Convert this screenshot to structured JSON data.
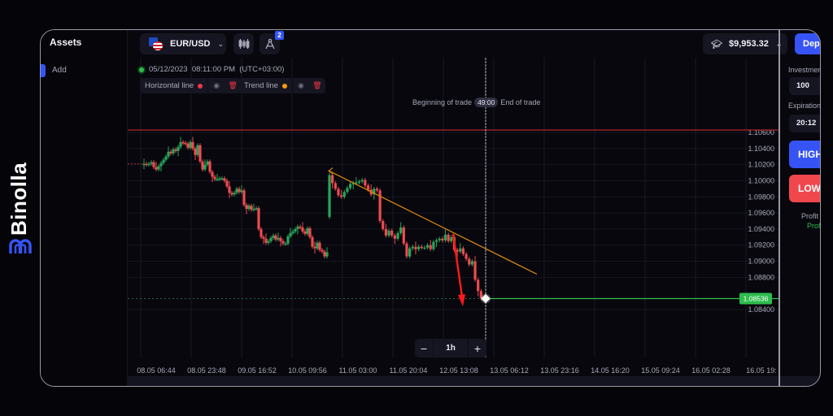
{
  "brand": {
    "name": "Binolla",
    "logo_icon": "binolla-logo-icon",
    "accent": "#3654f5"
  },
  "sidebar": {
    "title": "Assets",
    "items": [
      {
        "label": "Add"
      }
    ]
  },
  "toolbar": {
    "asset": {
      "label": "EUR/USD",
      "icon": "eu-us-flag-icon"
    },
    "chart_type_icon": "candlestick-icon",
    "drawing_tools_icon": "compass-icon",
    "drawing_tools_badge": "2",
    "balance": "$9,953.32",
    "balance_icon": "graduation-cap-icon",
    "deposit_label": "Depo"
  },
  "chart_header": {
    "datetime": "05/12/2023  08:11:00 PM  (UTC+03:00)",
    "drawings": [
      {
        "label": "Horizontal line",
        "color": "#f23645"
      },
      {
        "label": "Trend line",
        "color": "#f59e0b"
      }
    ]
  },
  "trade_marker": {
    "begin_label": "Beginning of trade",
    "timer": "49:00",
    "end_label": "End of trade"
  },
  "zoom_control": {
    "minus": "−",
    "value": "1h",
    "plus": "+"
  },
  "right_panel": {
    "investment_label": "Investmen",
    "investment_value": "100",
    "expiration_label": "Expiration",
    "expiration_value": "20:12",
    "high_label": "HIGH",
    "low_label": "LOWE",
    "profit_label": "Profit",
    "profit_value": "Profi"
  },
  "chart_data": {
    "type": "candlestick",
    "title": "EUR/USD",
    "timeframe": "1h",
    "y_ticks": [
      "1.10600",
      "1.10400",
      "1.10200",
      "1.10000",
      "1.09800",
      "1.09600",
      "1.09400",
      "1.09200",
      "1.09000",
      "1.08800",
      "1.08400"
    ],
    "ylim": [
      1.083,
      1.107
    ],
    "x_ticks": [
      "08.05 06:44",
      "08.05 23:48",
      "09.05 16:52",
      "10.05 09:56",
      "11.05 03:00",
      "11.05 20:04",
      "12.05 13:08",
      "13.05 06:12",
      "13.05 23:16",
      "14.05 16:20",
      "15.05 09:24",
      "16.05 02:28",
      "16.05 19:"
    ],
    "current_price": "1.08536",
    "current_price_value": 1.08536,
    "horizontal_line": 1.1063,
    "trend_line": {
      "start": {
        "index": 0.63,
        "price": 1.1012
      },
      "end": {
        "index": 12.35,
        "price": 1.0884
      }
    },
    "down_arrow": {
      "from": {
        "index": 9.92,
        "price": 1.0934
      },
      "to": {
        "index": 10.17,
        "price": 1.0848
      }
    },
    "colors": {
      "up": "#26a65b",
      "down": "#ef4a4f",
      "horizontal_line": "#b3262f",
      "trend_line": "#d4870f",
      "price_line": "#2ebd4d",
      "arrow": "#ff1a1a"
    },
    "candles_close": [
      1.1021,
      1.102,
      1.1021,
      1.1023,
      1.1017,
      1.1014,
      1.1018,
      1.1022,
      1.1026,
      1.103,
      1.1036,
      1.1034,
      1.1039,
      1.1037,
      1.1042,
      1.1048,
      1.1047,
      1.1046,
      1.1041,
      1.1048,
      1.104,
      1.1032,
      1.1044,
      1.1024,
      1.1014,
      1.102,
      1.1024,
      1.1011,
      1.1005,
      1.1002,
      1.1002,
      1.1003,
      1.1003,
      1.1,
      1.0993,
      1.0985,
      1.0983,
      1.0985,
      1.099,
      1.0986,
      1.0988,
      1.097,
      1.0965,
      1.0969,
      1.0964,
      1.0965,
      1.0966,
      1.094,
      1.093,
      1.0928,
      1.0923,
      1.0925,
      1.0929,
      1.0932,
      1.0927,
      1.0929,
      1.0925,
      1.0922,
      1.0922,
      1.0931,
      1.0935,
      1.0937,
      1.094,
      1.0943,
      1.0942,
      1.0937,
      1.0934,
      1.0941,
      1.093,
      1.0918,
      1.0916,
      1.0923,
      1.0914,
      1.0912,
      1.0906,
      1.0911,
      1.1007,
      1.0997,
      1.099,
      1.0982,
      1.098,
      1.0986,
      1.0991,
      1.0996,
      1.0997,
      1.0998,
      1.0999,
      1.1001,
      1.0994,
      1.0989,
      1.0983,
      1.099,
      1.0988,
      1.095,
      1.094,
      1.0932,
      1.0938,
      1.0932,
      1.0928,
      1.0935,
      1.0942,
      1.0922,
      1.0906,
      1.0916,
      1.0918,
      1.0915,
      1.0918,
      1.0917,
      1.0917,
      1.092,
      1.0915,
      1.0924,
      1.0926,
      1.0928,
      1.0926,
      1.0933,
      1.0925,
      1.093,
      1.0914,
      1.0912,
      1.0916,
      1.0909,
      1.0903,
      1.0896,
      1.09,
      1.0877,
      1.0863,
      1.0854
    ]
  }
}
